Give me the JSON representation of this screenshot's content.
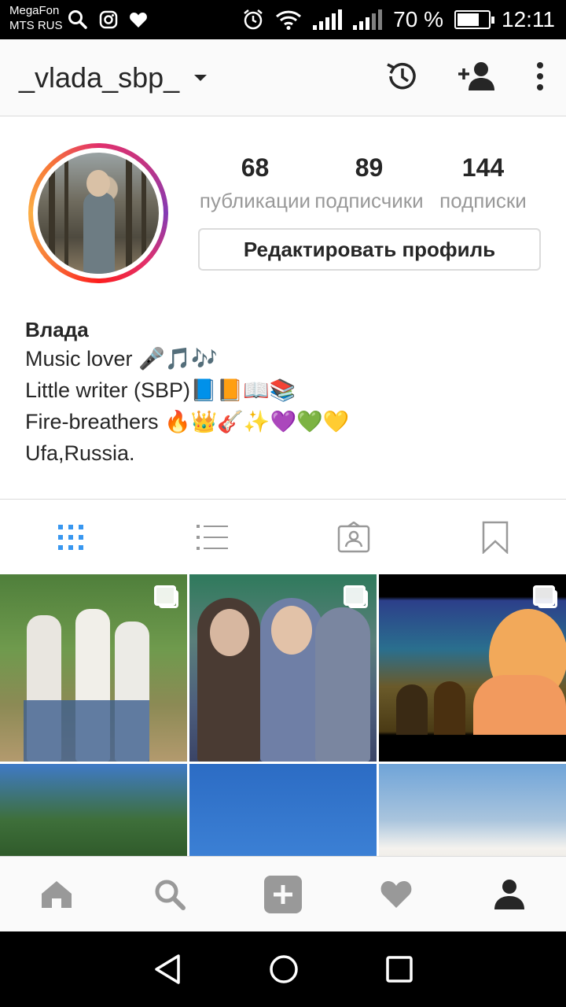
{
  "status_bar": {
    "carrier_1": "MegaFon",
    "carrier_2": "MTS RUS",
    "battery_percent": "70 %",
    "battery_level": 0.7,
    "time": "12:11",
    "icons": [
      "search-icon",
      "instagram-icon",
      "heart-icon",
      "alarm-icon",
      "wifi-icon",
      "signal-icon",
      "signal-icon",
      "battery-icon"
    ]
  },
  "header": {
    "username": "_vlada_sbp_"
  },
  "profile": {
    "stats": [
      {
        "value": "68",
        "label": "публикации"
      },
      {
        "value": "89",
        "label": "подписчики"
      },
      {
        "value": "144",
        "label": "подписки"
      }
    ],
    "edit_label": "Редактировать профиль"
  },
  "bio": {
    "name": "Влада",
    "lines": [
      "Music lover 🎤🎵🎶",
      "Little writer (SBP)📘📙📖📚",
      "Fire-breathers 🔥👑🎸✨💜💚💛",
      "Ufa,Russia."
    ]
  },
  "tabs": [
    {
      "icon": "grid-icon",
      "active": true
    },
    {
      "icon": "list-icon",
      "active": false
    },
    {
      "icon": "tagged-icon",
      "active": false
    },
    {
      "icon": "bookmark-icon",
      "active": false
    }
  ],
  "colors": {
    "active_tab": "#3897f0",
    "inactive_icon": "#999999",
    "text": "#262626",
    "muted": "#999999",
    "border": "#dbdbdb"
  },
  "bottom_nav": [
    "home-icon",
    "search-icon",
    "add-post-icon",
    "activity-heart-icon",
    "profile-icon"
  ],
  "system_nav": [
    "back-icon",
    "home-circle-icon",
    "recents-icon"
  ]
}
